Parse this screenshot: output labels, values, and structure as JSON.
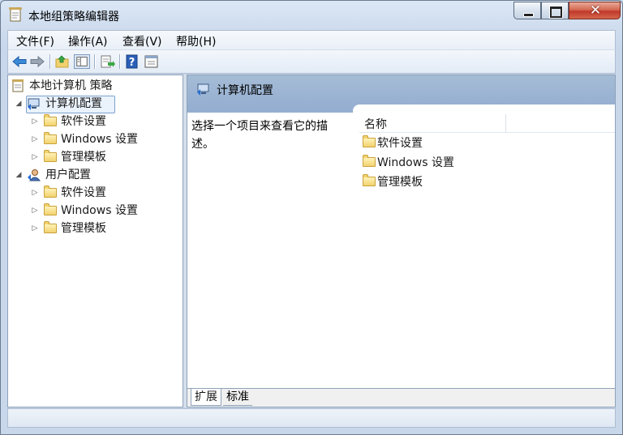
{
  "window": {
    "title": "本地组策略编辑器"
  },
  "menu": {
    "items": [
      {
        "label": "文件(F)"
      },
      {
        "label": "操作(A)"
      },
      {
        "label": "查看(V)"
      },
      {
        "label": "帮助(H)"
      }
    ]
  },
  "toolbar": {
    "buttons": [
      "back-arrow-icon",
      "forward-arrow-icon",
      "up-folder-icon",
      "show-hide-tree-icon",
      "export-list-icon",
      "help-icon",
      "properties-icon"
    ]
  },
  "tree": {
    "root": "本地计算机 策略",
    "computer_config": "计算机配置",
    "user_config": "用户配置",
    "children": [
      "软件设置",
      "Windows 设置",
      "管理模板"
    ]
  },
  "detail": {
    "header_title": "计算机配置",
    "description": "选择一个项目来查看它的描述。",
    "column_name": "名称",
    "items": [
      "软件设置",
      "Windows 设置",
      "管理模板"
    ]
  },
  "tabs": [
    {
      "label": "扩展"
    },
    {
      "label": "标准"
    }
  ]
}
